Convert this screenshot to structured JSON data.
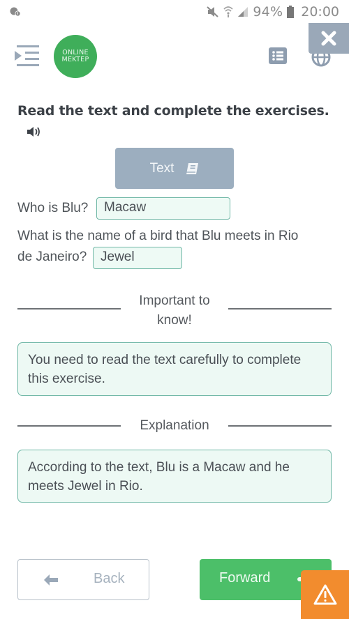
{
  "status_bar": {
    "battery_percent": "94%",
    "time": "20:00",
    "icons": [
      "notification-icon",
      "mute-icon",
      "wifi-icon",
      "signal-icon",
      "battery-icon"
    ]
  },
  "header": {
    "logo_line1": "ONLINE",
    "logo_line2": "MEKTEP",
    "icons": [
      "menu-toggle-icon",
      "list-icon",
      "globe-icon",
      "close-icon"
    ]
  },
  "colors": {
    "brand_green": "#3fae5a",
    "forward_green": "#4cbf69",
    "text_button_bg": "#9caebf",
    "answer_border": "#6fb7a6",
    "answer_bg": "#eefaf5",
    "warning_orange": "#f28c2e",
    "close_overlay": "#9aa8b8"
  },
  "main": {
    "title": "Read the text and complete the exercises.",
    "text_button_label": "Text",
    "questions": [
      {
        "text": "Who is Blu?",
        "answer": "Macaw"
      },
      {
        "text_line1": "What is the name of a bird that Blu meets in Rio",
        "text_line2": "de Janeiro?",
        "answer": "Jewel"
      }
    ],
    "important": {
      "heading_line1": "Important to",
      "heading_line2": "know!",
      "text": "You need to read the text carefully to complete this exercise."
    },
    "explanation": {
      "heading": "Explanation",
      "text": "According to the text, Blu is a Macaw and he meets Jewel in Rio."
    }
  },
  "footer": {
    "back_label": "Back",
    "forward_label": "Forward"
  }
}
